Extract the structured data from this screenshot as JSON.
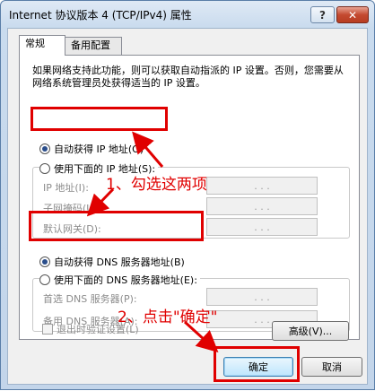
{
  "title": "Internet 协议版本 4 (TCP/IPv4) 属性",
  "titlebar": {
    "help_label": "?",
    "close_label": "✕",
    "help_icon": "question-mark-icon",
    "close_icon": "close-icon"
  },
  "tabs": [
    {
      "label": "常规",
      "active": true
    },
    {
      "label": "备用配置",
      "active": false
    }
  ],
  "description": "如果网络支持此功能，则可以获取自动指派的 IP 设置。否则，您需要从网络系统管理员处获得适当的 IP 设置。",
  "ip": {
    "auto_label": "自动获得 IP 地址(O)",
    "manual_label": "使用下面的 IP 地址(S):",
    "fields": [
      {
        "label": "IP 地址(I):",
        "value": ". . ."
      },
      {
        "label": "子网掩码(U):",
        "value": ". . ."
      },
      {
        "label": "默认网关(D):",
        "value": ". . ."
      }
    ]
  },
  "dns": {
    "auto_label": "自动获得 DNS 服务器地址(B)",
    "manual_label": "使用下面的 DNS 服务器地址(E):",
    "fields": [
      {
        "label": "首选 DNS 服务器(P):",
        "value": ". . ."
      },
      {
        "label": "备用 DNS 服务器(A):",
        "value": ". . ."
      }
    ]
  },
  "validate_label": "退出时验证设置(L)",
  "advanced_label": "高级(V)...",
  "ok_label": "确定",
  "cancel_label": "取消",
  "annotations": {
    "step1": "1、勾选这两项",
    "step2": "2、点击\"确定\""
  },
  "colors": {
    "annotation": "#e00000",
    "titlebar": "#c9dbee",
    "close": "#c44a30"
  }
}
